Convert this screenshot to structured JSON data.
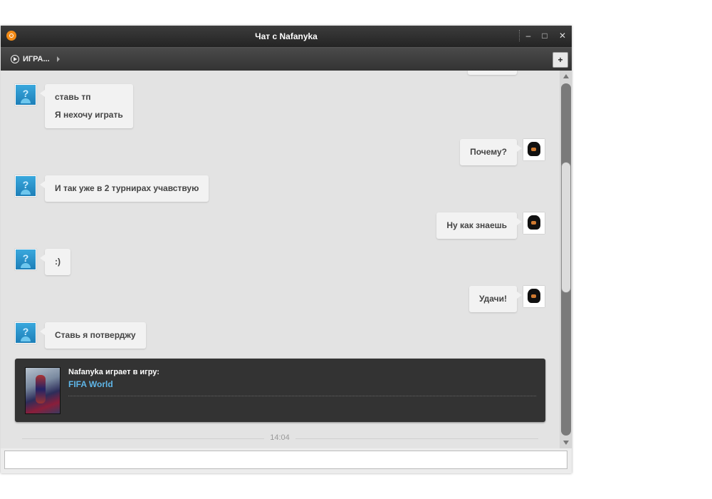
{
  "window": {
    "title": "Чат с Nafanyka",
    "controls": {
      "minimize": "–",
      "maximize": "□",
      "close": "✕"
    }
  },
  "toolbar": {
    "games_label": "ИГРА...",
    "add_friend_icon": "add-friend-icon"
  },
  "messages": [
    {
      "from": "them",
      "lines": [
        "ставь тп",
        "Я нехочу играть"
      ]
    },
    {
      "from": "me",
      "lines": [
        "Почему?"
      ]
    },
    {
      "from": "them",
      "lines": [
        "И так уже в 2 турнирах учавствую"
      ]
    },
    {
      "from": "me",
      "lines": [
        "Ну как знаешь"
      ]
    },
    {
      "from": "them",
      "lines": [
        ":)"
      ]
    },
    {
      "from": "me",
      "lines": [
        "Удачи!"
      ]
    },
    {
      "from": "them",
      "lines": [
        "Ставь я потверджу"
      ]
    }
  ],
  "game_card": {
    "status_text": "Nafanyka играет в игру:",
    "game_name": "FIFA World"
  },
  "timestamp": "14:04",
  "input": {
    "value": "",
    "placeholder": ""
  },
  "colors": {
    "titlebar": "#2e2e2e",
    "chat_background": "#e3e3e3",
    "bubble": "#f2f2f2",
    "game_link": "#5fb6e8",
    "origin_accent": "#f28a16"
  }
}
